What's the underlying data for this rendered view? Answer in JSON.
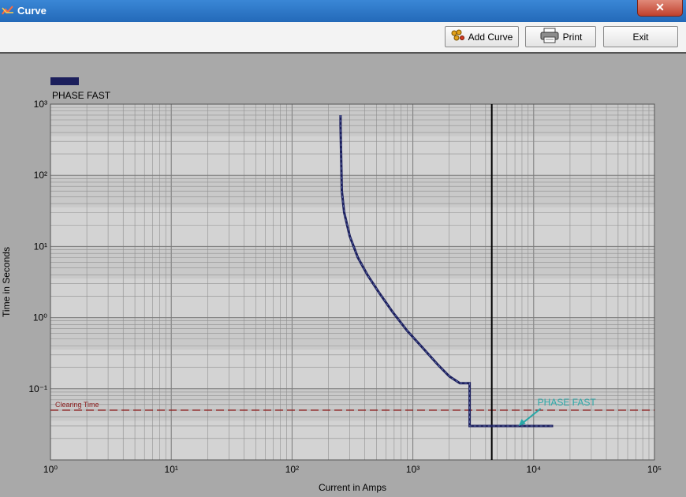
{
  "window": {
    "title": "Curve",
    "close_glyph": "✕",
    "icon": "curve-icon"
  },
  "toolbar": {
    "add_curve_label": "Add Curve",
    "add_curve_icon": "add-curve-icon",
    "print_label": "Print",
    "print_icon": "printer-icon",
    "exit_label": "Exit"
  },
  "colors": {
    "curve": "#1c1f5c",
    "clearing_line": "#8b1c1c",
    "annotation": "#2aa7a7",
    "plot_background": "#d3d3d3",
    "grid": "#8f8f8f"
  },
  "chart_data": {
    "type": "line",
    "x_scale": "log",
    "y_scale": "log",
    "xlabel": "Current in Amps",
    "ylabel": "Time in Seconds",
    "xlim": [
      1,
      100000
    ],
    "ylim": [
      0.01,
      1000
    ],
    "x_ticks": [
      "10⁰",
      "10¹",
      "10²",
      "10³",
      "10⁴",
      "10⁵"
    ],
    "y_ticks": [
      "10⁻¹",
      "10⁰",
      "10¹",
      "10²",
      "10³"
    ],
    "legend": {
      "position": "top-left",
      "entries": [
        "PHASE FAST"
      ]
    },
    "grid": true,
    "series": [
      {
        "name": "PHASE FAST",
        "x": [
          252,
          252,
          258,
          270,
          300,
          350,
          420,
          520,
          680,
          900,
          1200,
          1600,
          2000,
          2450,
          2950,
          2950,
          14500
        ],
        "y": [
          700,
          500,
          60,
          30,
          14,
          7,
          4,
          2.3,
          1.2,
          0.65,
          0.38,
          0.22,
          0.15,
          0.12,
          0.12,
          0.03,
          0.03
        ]
      }
    ],
    "reference_lines": [
      {
        "label": "Clearing Time",
        "y": 0.05,
        "style": "dashed"
      },
      {
        "label": "",
        "x": 4500,
        "style": "solid"
      }
    ],
    "annotations": [
      {
        "text": "PHASE FAST",
        "points_to": {
          "x": 7500,
          "y": 0.03
        }
      }
    ]
  }
}
